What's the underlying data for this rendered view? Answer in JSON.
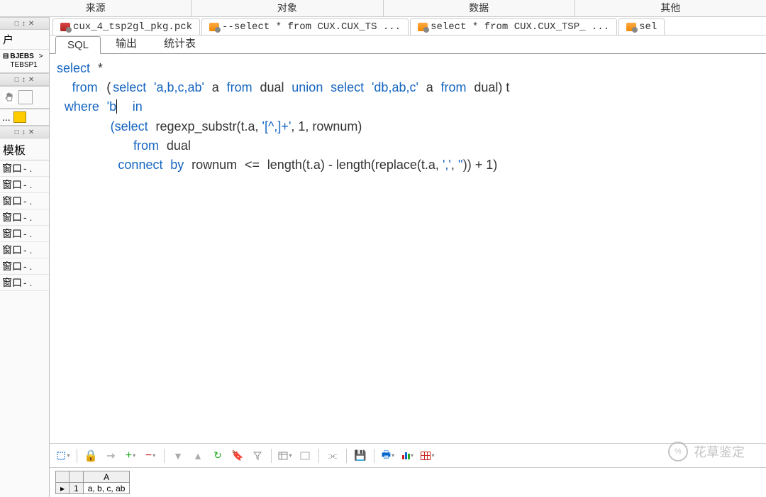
{
  "top_menu": [
    "来源",
    "对象",
    "数据",
    "其他"
  ],
  "dock_controls": [
    "□",
    "↕",
    "✕"
  ],
  "left": {
    "section1_title": "户",
    "tree_expand": "⊟",
    "tree_line1": "BJEBS",
    "tree_line2": "TEBSP1",
    "tree_arrow": ">",
    "input_dots": "...",
    "template_title": "模板",
    "template_items": [
      "窗口",
      "窗口",
      "窗口",
      "窗口",
      "窗口",
      "窗口",
      "窗口",
      "窗口"
    ],
    "template_dash": "-    ."
  },
  "file_tabs": [
    {
      "icon": "red",
      "text": "cux_4_tsp2gl_pkg.pck"
    },
    {
      "icon": "orange",
      "text": "--select * from CUX.CUX_TS ..."
    },
    {
      "icon": "orange",
      "text": "select * from CUX.CUX_TSP_ ..."
    },
    {
      "icon": "orange",
      "text": "sel"
    }
  ],
  "sub_tabs": [
    "SQL",
    "输出",
    "统计表"
  ],
  "code": {
    "line1": {
      "select": "select",
      "star": "*"
    },
    "line2": {
      "from": "from",
      "sel2": "select",
      "str1": "'a,b,c,ab'",
      "a1": "a",
      "from2": "from",
      "dual": "dual",
      "union": "union",
      "sel3": "select",
      "str2": "'db,ab,c'",
      "a2": "a",
      "from3": "from",
      "dual2": "dual",
      "t": ") t"
    },
    "line3": {
      "where": "where",
      "b": "'b",
      "in": "in"
    },
    "line4": {
      "sel": "(select",
      "fn": "regexp_substr",
      "args": "(t.a, ",
      "str": "'[^,]+'",
      "args2": ", 1, rownum)"
    },
    "line5": {
      "from": "from",
      "dual": "dual"
    },
    "line6": {
      "connect": "connect",
      "by": "by",
      "rownum": "rownum",
      "op": "<=",
      "len": "length",
      "ta": "(t.a) - ",
      "len2": "length",
      "rep": "(replace(t.a, ",
      "c1": "','",
      "c2": ", ",
      "c3": "''",
      "end": ")) + 1)"
    }
  },
  "result": {
    "header": "A",
    "row_num": "1",
    "row_marker": "▸",
    "row_data": "a, b, c, ab"
  },
  "watermark": {
    "icon": "%",
    "text": "花草鉴定"
  }
}
